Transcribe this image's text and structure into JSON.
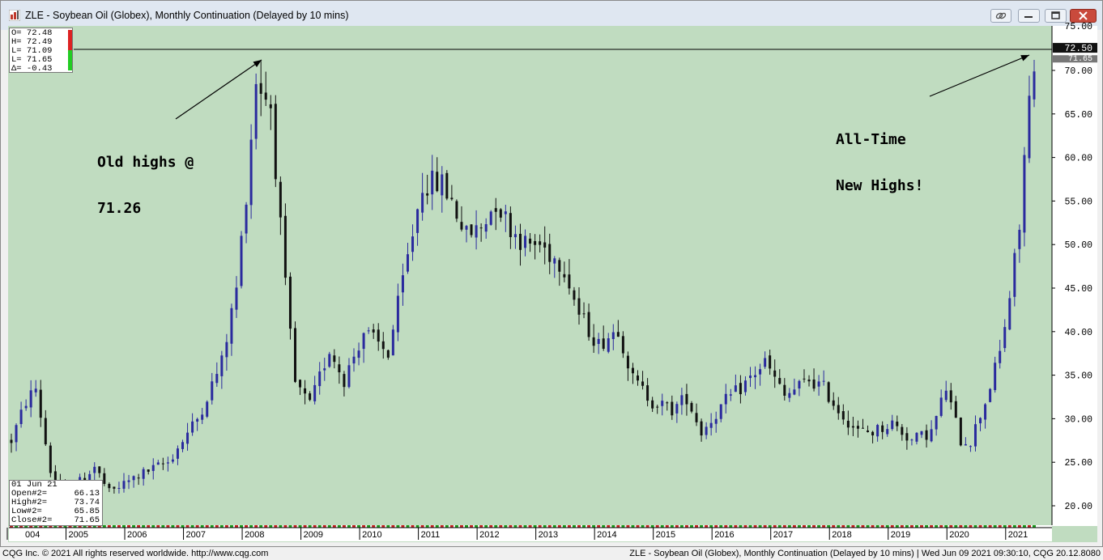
{
  "window": {
    "title": "ZLE - Soybean Oil (Globex), Monthly Continuation (Delayed by 10 mins)",
    "buttons": [
      "link-icon",
      "minimize-icon",
      "maximize-icon",
      "close-icon"
    ],
    "title_bar_color": "#dfe7f1",
    "close_color": "#c94a3c"
  },
  "ohlc_panel": {
    "rows": [
      {
        "label": "O=",
        "value": "72.48"
      },
      {
        "label": "H=",
        "value": "72.49"
      },
      {
        "label": "L=",
        "value": "71.09"
      },
      {
        "label": "L=",
        "value": "71.65"
      },
      {
        "label": "Δ=",
        "value": "-0.43"
      }
    ]
  },
  "info_panel": {
    "date": "01 Jun 21",
    "rows": [
      {
        "label": "Open#2=",
        "value": "66.13"
      },
      {
        "label": "High#2=",
        "value": "73.74"
      },
      {
        "label": "Low#2=",
        "value": "65.85"
      },
      {
        "label": "Close#2=",
        "value": "71.65"
      }
    ]
  },
  "annotations": {
    "old_highs_line1": "Old highs @",
    "old_highs_line2": "71.26",
    "new_highs_line1": "All-Time",
    "new_highs_line2": "New Highs!"
  },
  "price_labels": {
    "current": "72.50",
    "last": "71.65",
    "top_partial": "75.00"
  },
  "colors": {
    "background": "#c0dcc0",
    "up_bar": "#2a2a9e",
    "down_bar": "#111111",
    "price_tag": "#111111"
  },
  "chart_data": {
    "type": "bar",
    "style": "ohlc-candlestick",
    "title": "ZLE - Soybean Oil (Globex), Monthly Continuation",
    "ylim": [
      18,
      75.5
    ],
    "y_ticks": [
      20,
      25,
      30,
      35,
      40,
      45,
      50,
      55,
      60,
      65,
      70
    ],
    "y_tick_labels": [
      "20.00",
      "25.00",
      "30.00",
      "35.00",
      "40.00",
      "45.00",
      "50.00",
      "55.00",
      "60.00",
      "65.00",
      "70.00"
    ],
    "x_tick_labels": [
      "004",
      "2005",
      "2006",
      "2007",
      "2008",
      "2009",
      "2010",
      "2011",
      "2012",
      "2013",
      "2014",
      "2015",
      "2016",
      "2017",
      "2018",
      "2019",
      "2020",
      "2021"
    ],
    "x_range": [
      "2004-01",
      "2021-06"
    ],
    "reference_line": 71.26,
    "anchors": [
      [
        "2004-01",
        27.5
      ],
      [
        "2004-04",
        32.0
      ],
      [
        "2004-06",
        33.5
      ],
      [
        "2004-09",
        24.0
      ],
      [
        "2004-12",
        21.0
      ],
      [
        "2005-06",
        24.5
      ],
      [
        "2005-09",
        21.5
      ],
      [
        "2006-03",
        23.5
      ],
      [
        "2006-09",
        25.0
      ],
      [
        "2007-03",
        30.0
      ],
      [
        "2007-08",
        36.5
      ],
      [
        "2007-11",
        45.0
      ],
      [
        "2008-01",
        56.0
      ],
      [
        "2008-03",
        69.0
      ],
      [
        "2008-06",
        66.0
      ],
      [
        "2008-09",
        45.0
      ],
      [
        "2008-11",
        34.0
      ],
      [
        "2009-02",
        31.5
      ],
      [
        "2009-06",
        38.0
      ],
      [
        "2009-09",
        34.5
      ],
      [
        "2010-01",
        40.0
      ],
      [
        "2010-06",
        37.5
      ],
      [
        "2010-10",
        48.5
      ],
      [
        "2011-01",
        57.0
      ],
      [
        "2011-05",
        57.0
      ],
      [
        "2011-07",
        55.0
      ],
      [
        "2011-10",
        51.0
      ],
      [
        "2012-01",
        52.0
      ],
      [
        "2012-04",
        55.0
      ],
      [
        "2012-07",
        52.0
      ],
      [
        "2012-10",
        50.0
      ],
      [
        "2013-01",
        50.0
      ],
      [
        "2013-06",
        47.5
      ],
      [
        "2013-09",
        42.0
      ],
      [
        "2014-01",
        38.5
      ],
      [
        "2014-05",
        40.5
      ],
      [
        "2014-08",
        34.5
      ],
      [
        "2014-12",
        32.0
      ],
      [
        "2015-04",
        31.0
      ],
      [
        "2015-07",
        32.5
      ],
      [
        "2015-10",
        28.5
      ],
      [
        "2016-03",
        32.0
      ],
      [
        "2016-06",
        33.5
      ],
      [
        "2016-11",
        36.5
      ],
      [
        "2017-03",
        32.5
      ],
      [
        "2017-08",
        34.5
      ],
      [
        "2017-11",
        33.5
      ],
      [
        "2018-02",
        31.0
      ],
      [
        "2018-06",
        28.5
      ],
      [
        "2018-09",
        28.5
      ],
      [
        "2019-01",
        29.5
      ],
      [
        "2019-05",
        27.5
      ],
      [
        "2019-09",
        28.5
      ],
      [
        "2019-12",
        33.5
      ],
      [
        "2020-03",
        27.5
      ],
      [
        "2020-05",
        27.5
      ],
      [
        "2020-08",
        32.0
      ],
      [
        "2020-11",
        37.5
      ],
      [
        "2021-01",
        44.0
      ],
      [
        "2021-03",
        52.0
      ],
      [
        "2021-04",
        60.0
      ],
      [
        "2021-05",
        66.5
      ],
      [
        "2021-06",
        71.65
      ]
    ]
  }
}
